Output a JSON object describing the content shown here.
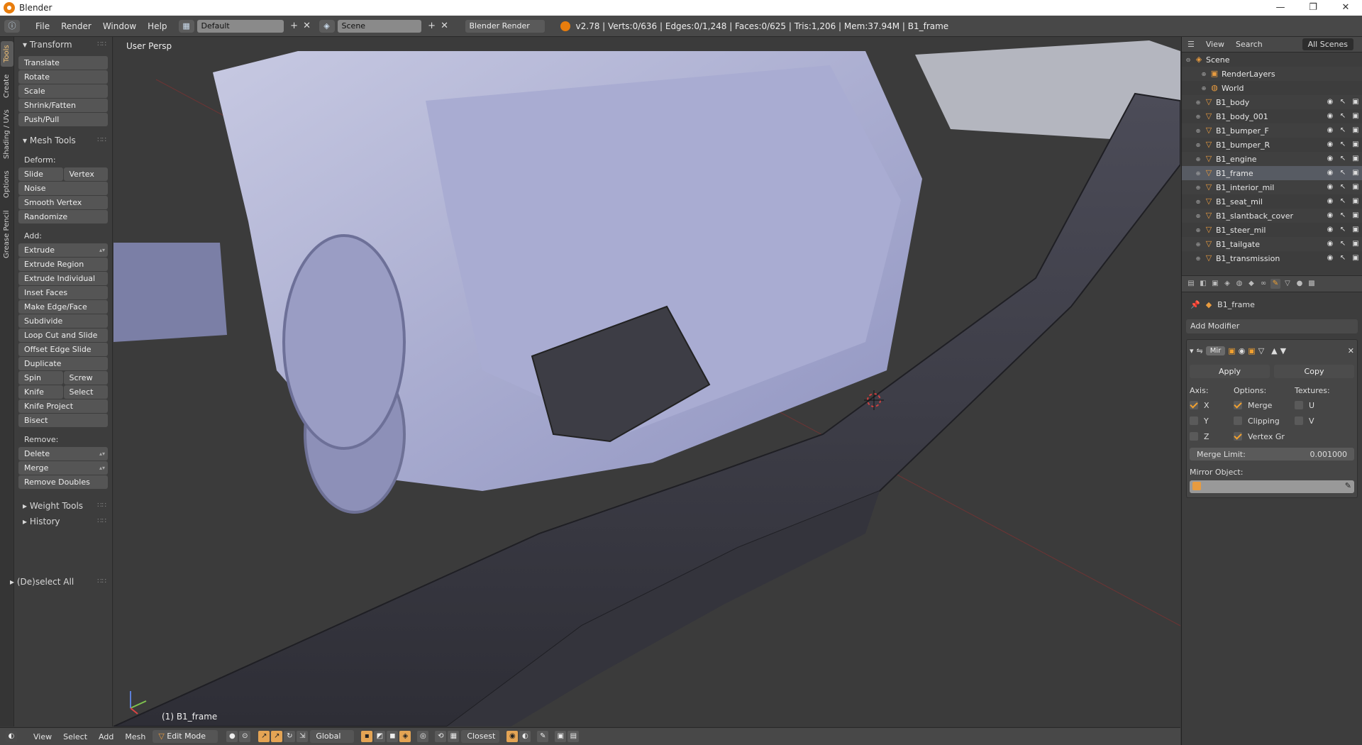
{
  "window": {
    "title": "Blender",
    "controls": [
      "—",
      "❐",
      "✕"
    ]
  },
  "info_header": {
    "menus": [
      "File",
      "Render",
      "Window",
      "Help"
    ],
    "layout": "Default",
    "scene": "Scene",
    "engine": "Blender Render",
    "stats": "v2.78 | Verts:0/636 | Edges:0/1,248 | Faces:0/625 | Tris:1,206 | Mem:37.94M | B1_frame"
  },
  "side_tabs": [
    "Tools",
    "Create",
    "Shading / UVs",
    "Options",
    "Grease Pencil"
  ],
  "tool_shelf": {
    "transform": {
      "title": "Transform",
      "buttons": [
        "Translate",
        "Rotate",
        "Scale",
        "Shrink/Fatten",
        "Push/Pull"
      ]
    },
    "mesh_tools": {
      "title": "Mesh Tools",
      "deform_label": "Deform:",
      "slide_edge": "Slide Edge",
      "vertex": "Vertex",
      "deform_buttons": [
        "Noise",
        "Smooth Vertex",
        "Randomize"
      ],
      "add_label": "Add:",
      "extrude": "Extrude",
      "add_buttons": [
        "Extrude Region",
        "Extrude Individual",
        "Inset Faces",
        "Make Edge/Face",
        "Subdivide",
        "Loop Cut and Slide",
        "Offset Edge Slide",
        "Duplicate"
      ],
      "spin": "Spin",
      "screw": "Screw",
      "knife": "Knife",
      "select": "Select",
      "knife_project": "Knife Project",
      "bisect": "Bisect",
      "remove_label": "Remove:",
      "delete": "Delete",
      "merge": "Merge",
      "remove_doubles": "Remove Doubles"
    },
    "weight_tools": "Weight Tools",
    "history": "History",
    "deselect_all": "(De)select All"
  },
  "viewport": {
    "view_name": "User Persp",
    "object_label": "(1) B1_frame"
  },
  "outliner": {
    "header": {
      "view": "View",
      "search": "Search",
      "filter": "All Scenes"
    },
    "items": [
      {
        "name": "Scene",
        "icon": "scene-icon"
      },
      {
        "name": "RenderLayers",
        "icon": "renderlayers-icon"
      },
      {
        "name": "World",
        "icon": "world-icon"
      },
      {
        "name": "B1_body",
        "icon": "mesh-icon"
      },
      {
        "name": "B1_body_001",
        "icon": "mesh-icon"
      },
      {
        "name": "B1_bumper_F",
        "icon": "mesh-icon"
      },
      {
        "name": "B1_bumper_R",
        "icon": "mesh-icon"
      },
      {
        "name": "B1_engine",
        "icon": "mesh-icon"
      },
      {
        "name": "B1_frame",
        "icon": "mesh-icon"
      },
      {
        "name": "B1_interior_mil",
        "icon": "mesh-icon"
      },
      {
        "name": "B1_seat_mil",
        "icon": "mesh-icon"
      },
      {
        "name": "B1_slantback_cover",
        "icon": "mesh-icon"
      },
      {
        "name": "B1_steer_mil",
        "icon": "mesh-icon"
      },
      {
        "name": "B1_tailgate",
        "icon": "mesh-icon"
      },
      {
        "name": "B1_transmission",
        "icon": "mesh-icon"
      }
    ]
  },
  "properties": {
    "object_name": "B1_frame",
    "add_modifier": "Add Modifier",
    "modifier": {
      "name": "Mir",
      "apply": "Apply",
      "copy": "Copy",
      "axis_label": "Axis:",
      "options_label": "Options:",
      "textures_label": "Textures:",
      "axis": [
        {
          "label": "X",
          "checked": true
        },
        {
          "label": "Y",
          "checked": false
        },
        {
          "label": "Z",
          "checked": false
        }
      ],
      "options": [
        {
          "label": "Merge",
          "checked": true
        },
        {
          "label": "Clipping",
          "checked": false
        },
        {
          "label": "Vertex Gr",
          "checked": true
        }
      ],
      "textures": [
        {
          "label": "U",
          "checked": false
        },
        {
          "label": "V",
          "checked": false
        }
      ],
      "merge_limit_label": "Merge Limit:",
      "merge_limit_value": "0.001000",
      "mirror_object_label": "Mirror Object:"
    }
  },
  "bottom_bar": {
    "menus": [
      "View",
      "Select",
      "Add",
      "Mesh"
    ],
    "mode": "Edit Mode",
    "orientation": "Global",
    "snap": "Closest"
  }
}
